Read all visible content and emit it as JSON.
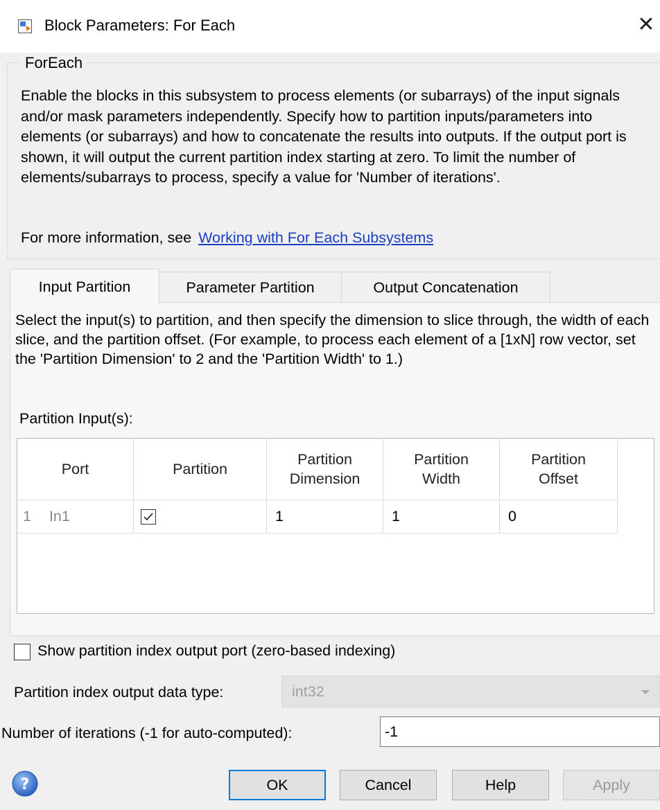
{
  "window": {
    "title": "Block Parameters: For Each"
  },
  "group": {
    "legend": "ForEach",
    "description": "Enable the blocks in this subsystem to process elements (or subarrays) of the input signals and/or mask parameters independently. Specify how to partition inputs/parameters into elements (or subarrays) and how to concatenate the results into outputs. If the output port is shown, it will output the current partition index starting at zero.  To limit the number of elements/subarrays to process, specify a value for 'Number of iterations'.",
    "more_info_prefix": "For more information, see",
    "more_info_link": "Working with For Each Subsystems"
  },
  "tabs": [
    {
      "label": "Input Partition",
      "active": true
    },
    {
      "label": "Parameter Partition",
      "active": false
    },
    {
      "label": "Output Concatenation",
      "active": false
    }
  ],
  "input_partition": {
    "description": "Select the input(s) to partition, and then specify the dimension to slice through, the width of each slice, and the partition offset. (For example, to process each element of a [1xN] row vector, set the 'Partition Dimension' to 2 and the 'Partition Width' to 1.)",
    "table_label": "Partition Input(s):",
    "columns": [
      "Port",
      "Partition",
      "Partition Dimension",
      "Partition Width",
      "Partition Offset"
    ],
    "rows": [
      {
        "index": "1",
        "port": "In1",
        "partition": true,
        "dimension": "1",
        "width": "1",
        "offset": "0"
      }
    ]
  },
  "show_index_port": {
    "label": "Show partition index output port (zero-based indexing)",
    "checked": false
  },
  "index_data_type": {
    "label": "Partition index output data type:",
    "value": "int32",
    "enabled": false
  },
  "iterations": {
    "label": "Number of iterations (-1 for auto-computed):",
    "value": "-1"
  },
  "buttons": {
    "ok": "OK",
    "cancel": "Cancel",
    "help": "Help",
    "apply": "Apply"
  },
  "colors": {
    "link": "#1a3ec2",
    "default_button_border": "#0078d7",
    "background": "#f0f0f0"
  }
}
